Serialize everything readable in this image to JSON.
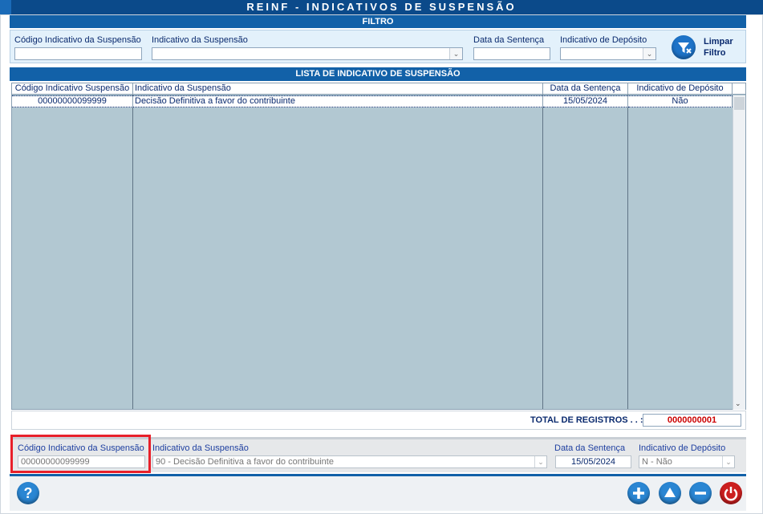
{
  "window": {
    "title": "REINF - INDICATIVOS DE SUSPENSÃO"
  },
  "filter": {
    "section_title": "FILTRO",
    "codigo_label": "Código Indicativo da Suspensão",
    "codigo_value": "",
    "indicativo_label": "Indicativo da Suspensão",
    "indicativo_value": "",
    "data_label": "Data da Sentença",
    "data_value": "",
    "deposito_label": "Indicativo de Depósito",
    "deposito_value": "",
    "clear_label_1": "Limpar",
    "clear_label_2": "Filtro",
    "clear_icon": "funnel-clear-icon"
  },
  "list": {
    "section_title": "LISTA DE INDICATIVO DE SUSPENSÃO",
    "columns": [
      "Código Indicativo Suspensão",
      "Indicativo da Suspensão",
      "Data da Sentença",
      "Indicativo de Depósito"
    ],
    "rows": [
      {
        "codigo": "00000000099999",
        "indicativo": "Decisão Definitiva a favor do contribuinte",
        "data": "15/05/2024",
        "deposito": "Não"
      }
    ]
  },
  "totals": {
    "label": "TOTAL DE REGISTROS . . :",
    "value": "0000000001"
  },
  "detail": {
    "codigo_label": "Código Indicativo da Suspensão",
    "codigo_value": "00000000099999",
    "indicativo_label": "Indicativo da Suspensão",
    "indicativo_value": "90 - Decisão Definitiva a favor do contribuinte",
    "data_label": "Data da Sentença",
    "data_value": "15/05/2024",
    "deposito_label": "Indicativo de Depósito",
    "deposito_value": "N - Não"
  },
  "toolbar": {
    "help_icon": "question-icon",
    "add_icon": "plus-icon",
    "edit_icon": "up-arrow-icon",
    "remove_icon": "minus-icon",
    "exit_icon": "power-icon"
  },
  "colors": {
    "header": "#0b4a8a",
    "section": "#1261a8",
    "grid_bg": "#b2c8d2",
    "highlight": "#e8202a",
    "total_value": "#cc0000"
  }
}
